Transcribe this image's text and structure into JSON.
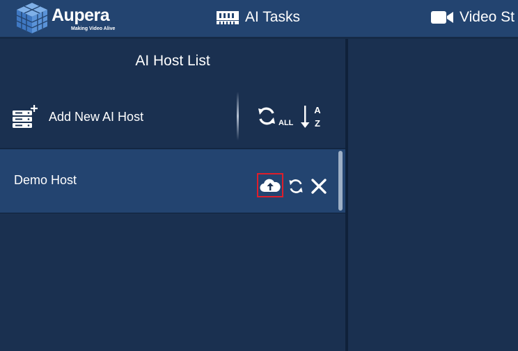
{
  "brand": {
    "name": "Aupera",
    "tagline": "Making Video Alive",
    "logo_icon": "cube-logo-icon"
  },
  "nav": {
    "items": [
      {
        "label": "AI Tasks",
        "icon": "memory-chip-icon"
      },
      {
        "label": "Video St",
        "icon": "video-camera-icon"
      }
    ]
  },
  "host_panel": {
    "title": "AI Host List",
    "add_button_label": "Add New AI Host",
    "add_icon": "server-add-icon",
    "refresh_all_label": "ALL",
    "refresh_all_icon": "refresh-icon",
    "sort_icon": "sort-a-z-icon",
    "sort_letters": [
      "A",
      "Z"
    ],
    "hosts": [
      {
        "name": "Demo Host",
        "actions": [
          "cloud-upload-icon",
          "refresh-icon",
          "close-icon"
        ]
      }
    ]
  },
  "colors": {
    "background": "#1a3050",
    "topbar": "#234470",
    "selected_row": "#234470",
    "highlight_box": "#e01e2a",
    "text": "#ffffff"
  }
}
